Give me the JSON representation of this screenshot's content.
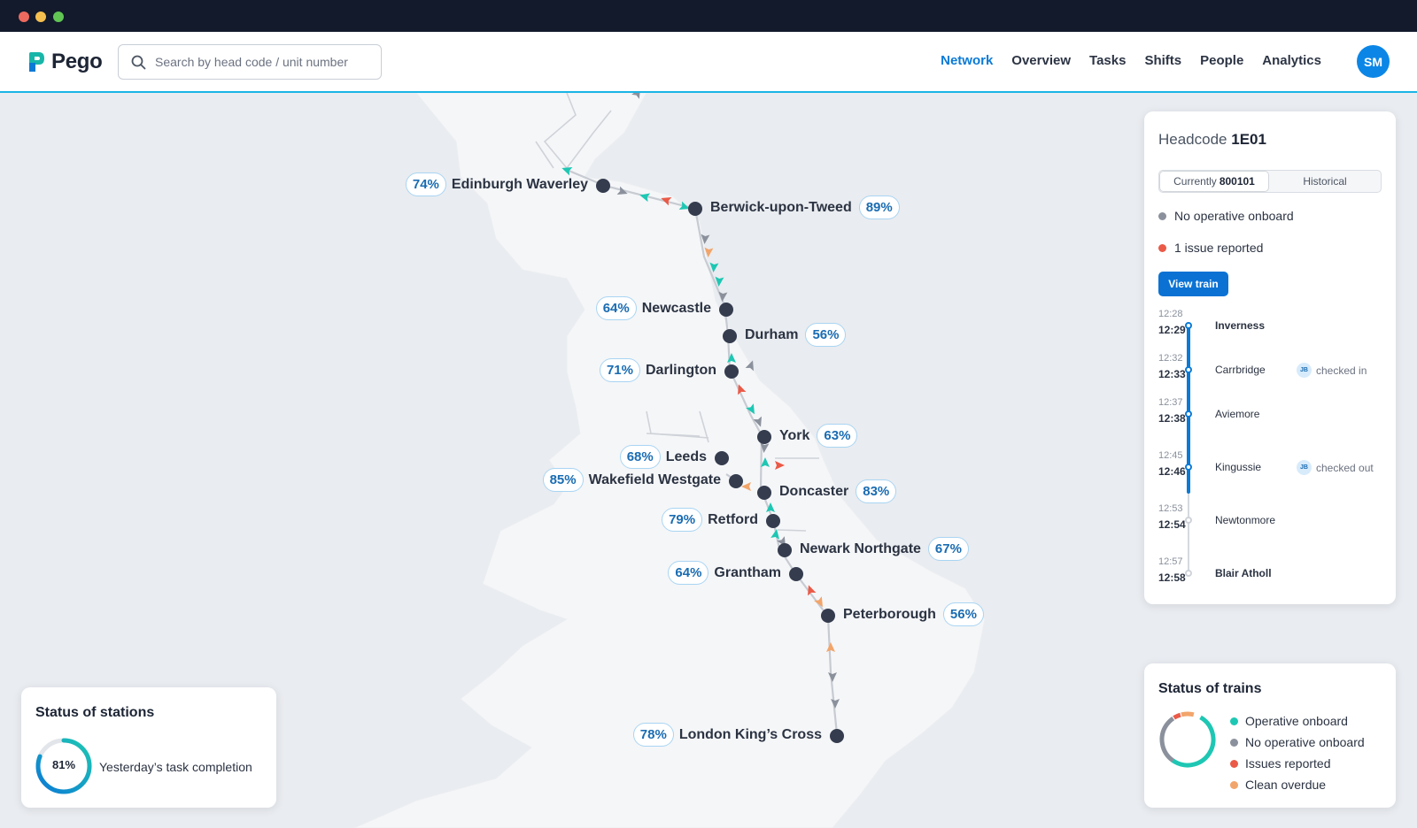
{
  "app": {
    "name": "Pego"
  },
  "search": {
    "placeholder": "Search by head code / unit number"
  },
  "nav": {
    "items": [
      "Network",
      "Overview",
      "Tasks",
      "Shifts",
      "People",
      "Analytics"
    ],
    "active": "Network"
  },
  "user": {
    "initials": "SM"
  },
  "colors": {
    "accent": "#0b7ad6",
    "operative": "#1ec7b3",
    "no_operative": "#8b919c",
    "issue": "#ea5a47",
    "clean_overdue": "#f2a56b"
  },
  "stations": [
    {
      "name": "Edinburgh Waverley",
      "pct": "74%"
    },
    {
      "name": "Berwick-upon-Tweed",
      "pct": "89%"
    },
    {
      "name": "Newcastle",
      "pct": "64%"
    },
    {
      "name": "Durham",
      "pct": "56%"
    },
    {
      "name": "Darlington",
      "pct": "71%"
    },
    {
      "name": "York",
      "pct": "63%"
    },
    {
      "name": "Leeds",
      "pct": "68%"
    },
    {
      "name": "Wakefield Westgate",
      "pct": "85%"
    },
    {
      "name": "Doncaster",
      "pct": "83%"
    },
    {
      "name": "Retford",
      "pct": "79%"
    },
    {
      "name": "Newark Northgate",
      "pct": "67%"
    },
    {
      "name": "Grantham",
      "pct": "64%"
    },
    {
      "name": "Peterborough",
      "pct": "56%"
    },
    {
      "name": "London King’s Cross",
      "pct": "78%"
    }
  ],
  "train_panel": {
    "headcode_label": "Headcode",
    "headcode": "1E01",
    "tab_current_prefix": "Currently",
    "tab_current_unit": "800101",
    "tab_historical": "Historical",
    "status_operative": "No operative onboard",
    "status_issues": "1 issue reported",
    "view_button": "View train",
    "timeline": [
      {
        "sched": "12:28",
        "actual": "12:29",
        "stop": "Inverness",
        "chip": ""
      },
      {
        "sched": "12:32",
        "actual": "12:33",
        "stop": "Carrbridge",
        "chip_initials": "JB",
        "chip": "checked in"
      },
      {
        "sched": "12:37",
        "actual": "12:38",
        "stop": "Aviemore",
        "chip": ""
      },
      {
        "sched": "12:45",
        "actual": "12:46",
        "stop": "Kingussie",
        "chip_initials": "JB",
        "chip": "checked out"
      },
      {
        "sched": "12:53",
        "actual": "12:54",
        "stop": "Newtonmore",
        "chip": ""
      },
      {
        "sched": "12:57",
        "actual": "12:58",
        "stop": "Blair Atholl",
        "chip": ""
      }
    ]
  },
  "stations_status": {
    "title": "Status of stations",
    "value_label": "81%",
    "value": 0.81,
    "caption": "Yesterday’s task completion"
  },
  "trains_status": {
    "title": "Status of trains",
    "legend": [
      "Operative onboard",
      "No operative onboard",
      "Issues reported",
      "Clean overdue"
    ]
  }
}
